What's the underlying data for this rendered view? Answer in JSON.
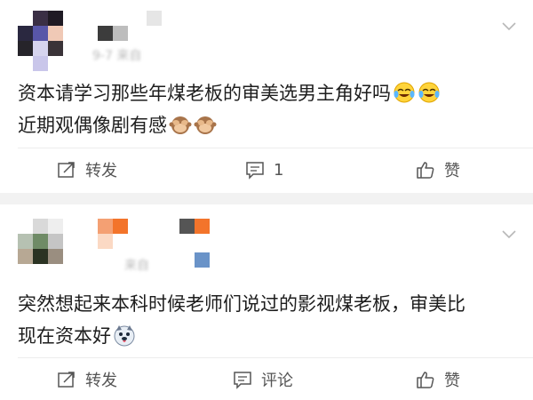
{
  "posts": [
    {
      "meta": "9-7 来自",
      "content_line1": "资本请学习那些年煤老板的审美选男主角好吗",
      "content_line2": "近期观偶像剧有感",
      "emoji_line1": [
        "laugh-cry-emoji",
        "laugh-cry-emoji"
      ],
      "emoji_line2": [
        "see-no-evil-monkey-emoji",
        "see-no-evil-monkey-emoji"
      ],
      "actions": {
        "repost": "转发",
        "comment": "1",
        "like": "赞"
      }
    },
    {
      "meta": "来自",
      "content_line1": "突然想起来本科时候老师们说过的影视煤老板，审美比",
      "content_line2": "现在资本好",
      "emoji_line2": [
        "husky-dog-emoji"
      ],
      "actions": {
        "repost": "转发",
        "comment": "评论",
        "like": "赞"
      }
    }
  ],
  "colors": {
    "text": "#1d1d1d",
    "action": "#555555",
    "separator": "#f2f2f2",
    "orange": "#f3742b",
    "blue": "#6a93c8"
  }
}
